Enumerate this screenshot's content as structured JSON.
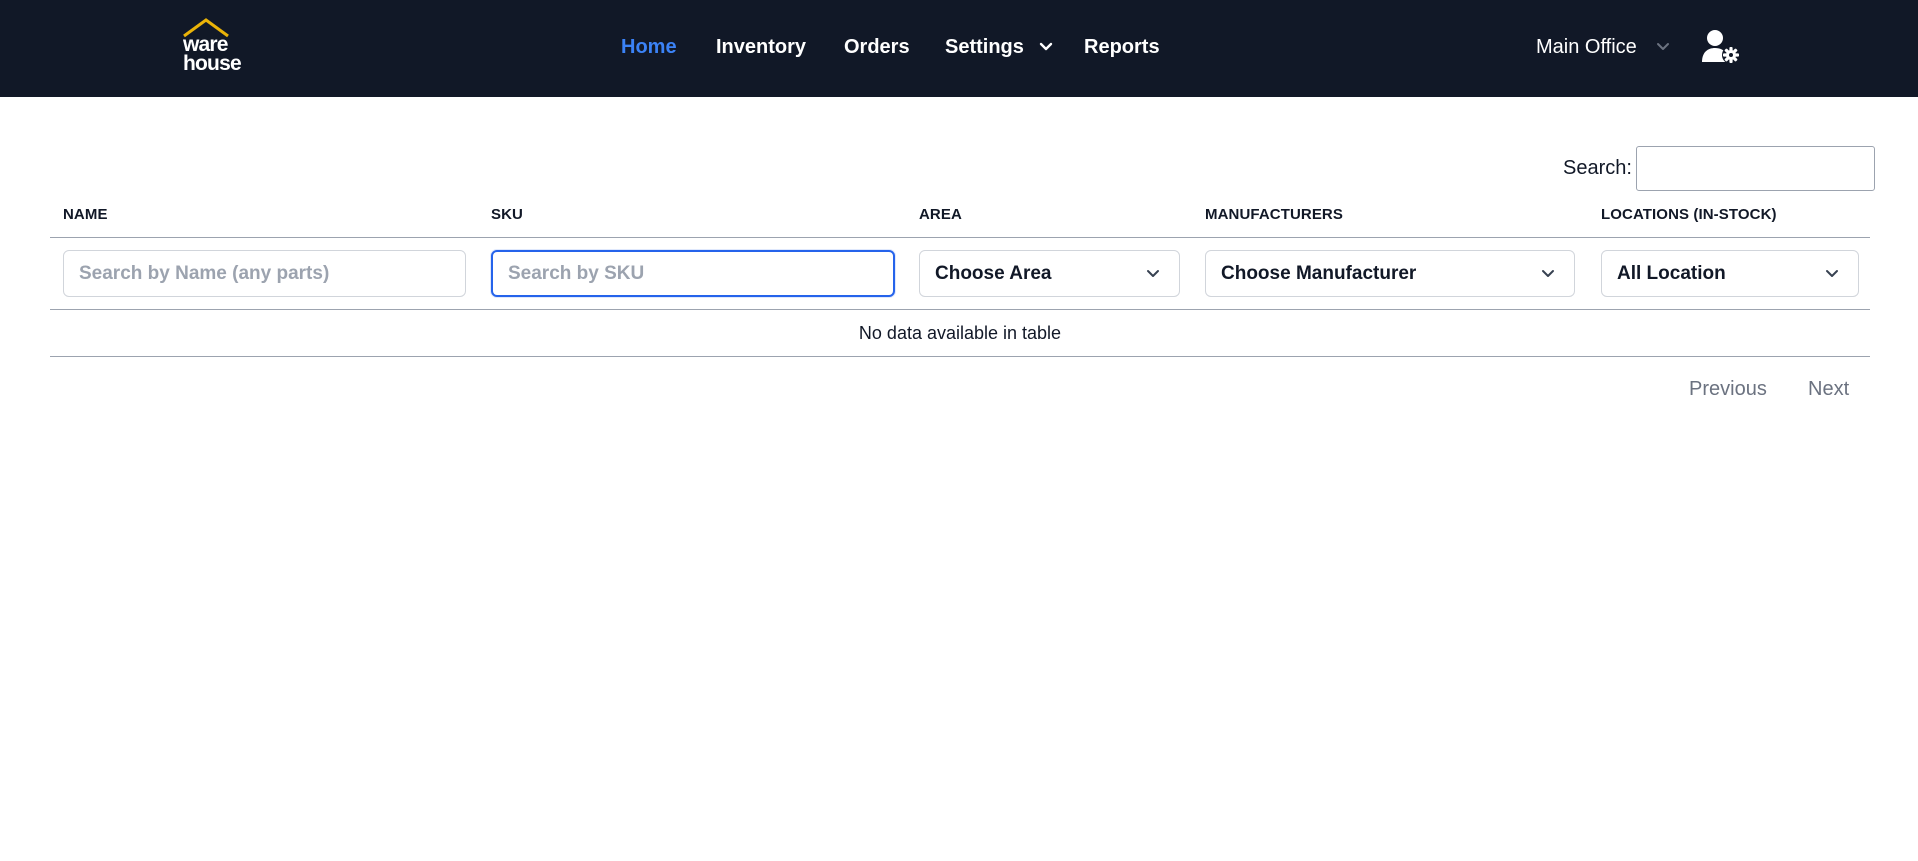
{
  "brand": {
    "line1": "ware",
    "line2": "house",
    "accent_color": "#eab308"
  },
  "nav": {
    "home": "Home",
    "inventory": "Inventory",
    "orders": "Orders",
    "settings": "Settings",
    "reports": "Reports",
    "active": "Home",
    "active_color": "#3b82f6"
  },
  "office": {
    "label": "Main Office"
  },
  "icons": {
    "user_settings": "user-gear-icon",
    "chevron": "chevron-down-icon"
  },
  "search": {
    "label": "Search:",
    "value": ""
  },
  "table": {
    "columns": [
      "NAME",
      "SKU",
      "AREA",
      "MANUFACTURERS",
      "LOCATIONS (IN-STOCK)"
    ],
    "filters": {
      "name_placeholder": "Search by Name (any parts)",
      "sku_placeholder": "Search by SKU",
      "area_selected": "Choose Area",
      "manufacturer_selected": "Choose Manufacturer",
      "location_selected": "All Location"
    },
    "empty_message": "No data available in table"
  },
  "pagination": {
    "previous": "Previous",
    "next": "Next"
  }
}
